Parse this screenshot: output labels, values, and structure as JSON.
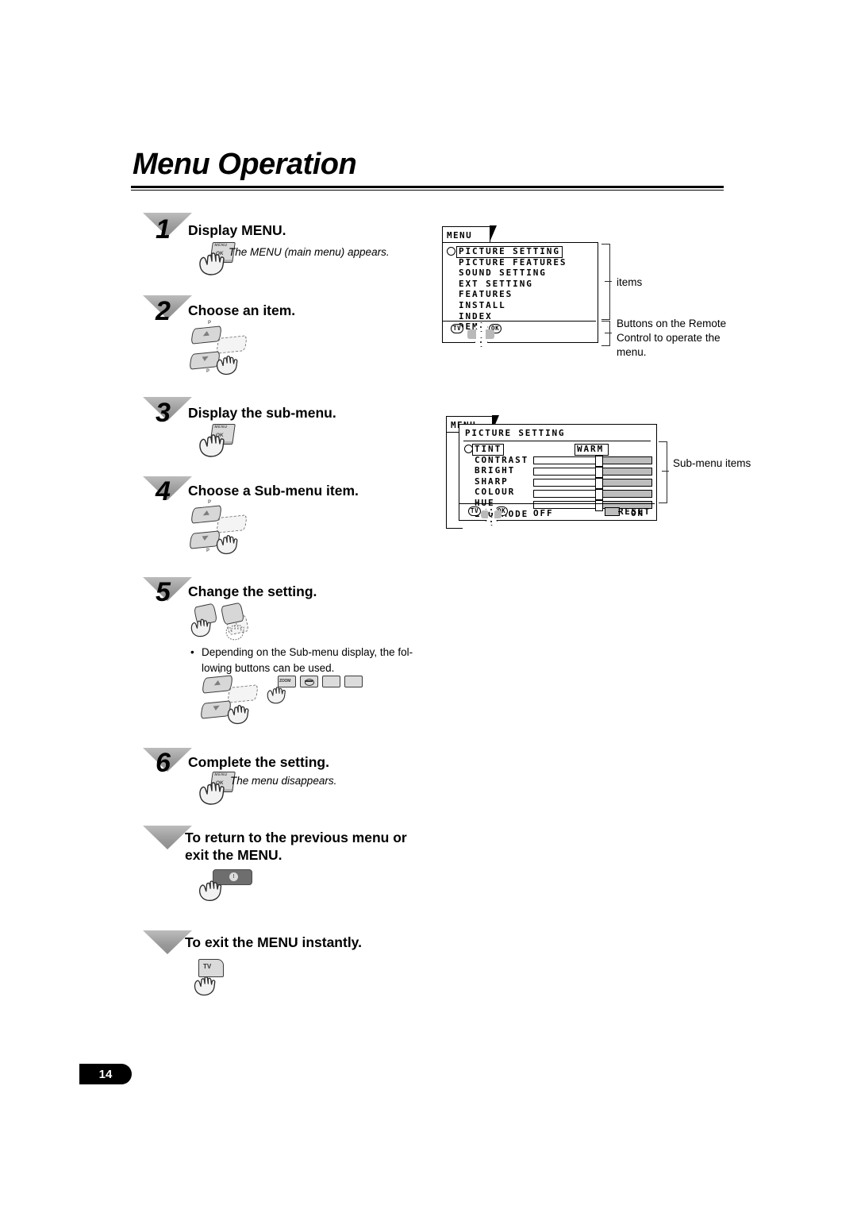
{
  "page": {
    "title": "Menu Operation",
    "page_number": "14"
  },
  "steps": [
    {
      "num": "1",
      "text": "Display MENU.",
      "note": "The MENU (main menu) appears."
    },
    {
      "num": "2",
      "text": "Choose an item.",
      "note": ""
    },
    {
      "num": "3",
      "text": "Display the sub-menu.",
      "note": ""
    },
    {
      "num": "4",
      "text": "Choose a Sub-menu item.",
      "note": ""
    },
    {
      "num": "5",
      "text": "Change the setting.",
      "note": ""
    },
    {
      "num": "6",
      "text": "Complete the setting.",
      "note": "The menu disappears."
    }
  ],
  "extra_steps": [
    {
      "text": "To return to the previous menu or exit the MENU."
    },
    {
      "text": "To exit the MENU instantly."
    }
  ],
  "bullet": {
    "marker": "•",
    "text": "Depending on the Sub-menu display, the fol-lowing buttons can be used."
  },
  "keys": {
    "menu": "MENU",
    "ok": "OK",
    "tv": "TV",
    "zoom": "ZOOM",
    "p_up": "P",
    "p_down": "P"
  },
  "main_menu": {
    "tab_label": "MENU",
    "items": [
      "PICTURE SETTING",
      "PICTURE FEATURES",
      "SOUND SETTING",
      "EXT SETTING",
      "FEATURES",
      "INSTALL",
      "INDEX",
      "DEMO"
    ],
    "selected_index": 0,
    "footer_badges": [
      "TV",
      "OK"
    ],
    "callouts": [
      {
        "label": "items"
      },
      {
        "label": "Buttons on the Remote Control to operate the menu."
      }
    ]
  },
  "sub_menu": {
    "tab_label": "MENU",
    "header": "PICTURE SETTING",
    "rows": [
      {
        "label": "TINT",
        "type": "value",
        "value": "WARM",
        "selected": true
      },
      {
        "label": "CONTRAST",
        "type": "slider",
        "value": 55
      },
      {
        "label": "BRIGHT",
        "type": "slider",
        "value": 55
      },
      {
        "label": "SHARP",
        "type": "slider",
        "value": 55
      },
      {
        "label": "COLOUR",
        "type": "slider",
        "value": 55
      },
      {
        "label": "HUE",
        "type": "slider",
        "value": 55
      },
      {
        "label": "ECO MODE",
        "type": "toggle",
        "off_label": "OFF",
        "on_label": "ON"
      }
    ],
    "footer_badges": [
      "TV",
      "OK"
    ],
    "reset_label": "RESET",
    "callouts": [
      {
        "label": "Sub-menu items"
      }
    ]
  }
}
